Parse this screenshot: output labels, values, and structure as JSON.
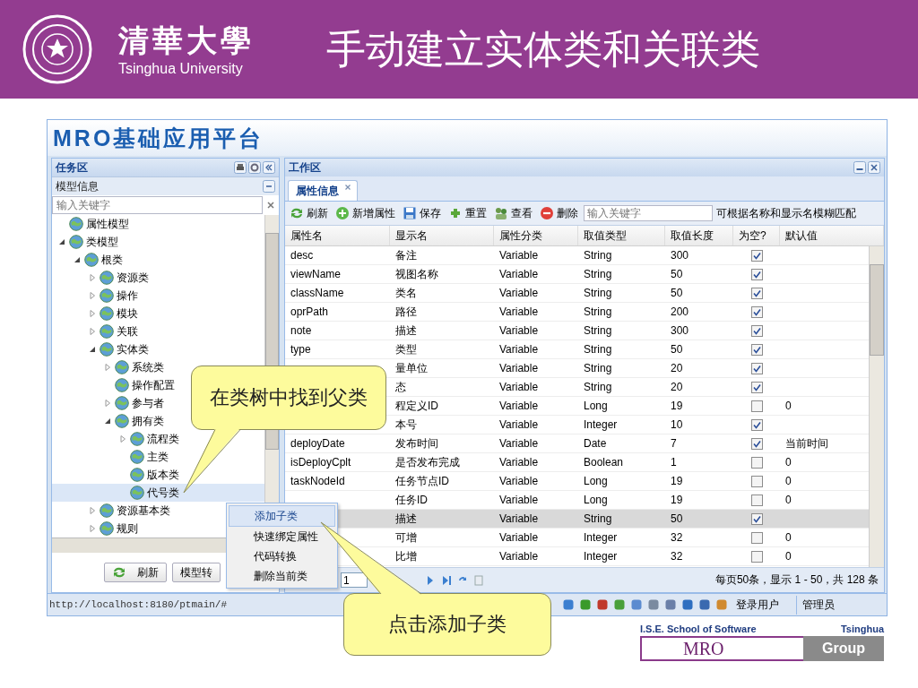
{
  "slide": {
    "university_name": "清華大學",
    "university_name_en": "Tsinghua University",
    "title": "手动建立实体类和关联类"
  },
  "app": {
    "title": "MRO基础应用平台",
    "task_panel": {
      "title": "任务区",
      "section": "模型信息",
      "search": {
        "placeholder": "输入关键字"
      },
      "tree": [
        {
          "label": "属性模型",
          "selected": false
        },
        {
          "label": "类模型",
          "selected": false,
          "expanded": true,
          "children": [
            {
              "label": "根类",
              "selected": false,
              "expanded": true,
              "children": [
                {
                  "label": "资源类",
                  "selected": false,
                  "expanded": false
                },
                {
                  "label": "操作",
                  "selected": false,
                  "expanded": false
                },
                {
                  "label": "模块",
                  "selected": false,
                  "expanded": false
                },
                {
                  "label": "关联",
                  "selected": false,
                  "expanded": false
                },
                {
                  "label": "实体类",
                  "selected": false,
                  "expanded": true,
                  "children": [
                    {
                      "label": "系统类",
                      "selected": false,
                      "expanded": false
                    },
                    {
                      "label": "操作配置",
                      "selected": false
                    },
                    {
                      "label": "参与者",
                      "selected": false,
                      "expanded": false
                    },
                    {
                      "label": "拥有类",
                      "selected": false,
                      "expanded": true,
                      "children": [
                        {
                          "label": "流程类",
                          "selected": false,
                          "expanded": false
                        },
                        {
                          "label": "主类",
                          "selected": false
                        },
                        {
                          "label": "版本类",
                          "selected": false
                        },
                        {
                          "label": "代号类",
                          "selected": true
                        }
                      ]
                    }
                  ]
                },
                {
                  "label": "资源基本类",
                  "selected": false,
                  "expanded": false
                },
                {
                  "label": "规则",
                  "selected": false,
                  "expanded": false
                }
              ]
            }
          ]
        }
      ],
      "buttons": [
        {
          "label": "刷新"
        },
        {
          "label": "模型转"
        }
      ]
    },
    "work_panel": {
      "title": "工作区",
      "tabs": [
        {
          "label": "属性信息",
          "selected": true
        }
      ],
      "toolbar": [
        {
          "label": "刷新"
        },
        {
          "label": "新增属性"
        },
        {
          "label": "保存"
        },
        {
          "label": "重置"
        },
        {
          "label": "查看"
        },
        {
          "label": "删除"
        }
      ],
      "search": {
        "placeholder": "输入关键字"
      },
      "search_hint": "可根据名称和显示名模糊匹配",
      "table": {
        "columns": [
          "属性名",
          "显示名",
          "属性分类",
          "取值类型",
          "取值长度",
          "为空?",
          "默认值"
        ],
        "rows": [
          {
            "name": "desc",
            "display": "备注",
            "category": "Variable",
            "type": "String",
            "length": "300",
            "nullable": true,
            "selected": false
          },
          {
            "name": "viewName",
            "display": "视图名称",
            "category": "Variable",
            "type": "String",
            "length": "50",
            "nullable": true,
            "selected": false
          },
          {
            "name": "className",
            "display": "类名",
            "category": "Variable",
            "type": "String",
            "length": "50",
            "nullable": true,
            "selected": false
          },
          {
            "name": "oprPath",
            "display": "路径",
            "category": "Variable",
            "type": "String",
            "length": "200",
            "nullable": true,
            "selected": false
          },
          {
            "name": "note",
            "display": "描述",
            "category": "Variable",
            "type": "String",
            "length": "300",
            "nullable": true,
            "selected": false
          },
          {
            "name": "type",
            "display": "类型",
            "category": "Variable",
            "type": "String",
            "length": "50",
            "nullable": true,
            "selected": false
          },
          {
            "display": "量单位",
            "category": "Variable",
            "type": "String",
            "length": "20",
            "nullable": true,
            "selected": false
          },
          {
            "display": "态",
            "category": "Variable",
            "type": "String",
            "length": "20",
            "nullable": true,
            "selected": false
          },
          {
            "display": "程定义ID",
            "category": "Variable",
            "type": "Long",
            "length": "19",
            "nullable": false,
            "default": "0",
            "selected": false
          },
          {
            "display": "本号",
            "category": "Variable",
            "type": "Integer",
            "length": "10",
            "nullable": true,
            "selected": false
          },
          {
            "name": "deployDate",
            "display": "发布时间",
            "category": "Variable",
            "type": "Date",
            "length": "7",
            "nullable": true,
            "default": "当前时间",
            "selected": false
          },
          {
            "name": "isDeployCplt",
            "display": "是否发布完成",
            "category": "Variable",
            "type": "Boolean",
            "length": "1",
            "nullable": false,
            "default": "0",
            "selected": false
          },
          {
            "name": "taskNodeId",
            "display": "任务节点ID",
            "category": "Variable",
            "type": "Long",
            "length": "19",
            "nullable": false,
            "default": "0",
            "selected": false
          },
          {
            "display": "任务ID",
            "category": "Variable",
            "type": "Long",
            "length": "19",
            "nullable": false,
            "default": "0",
            "selected": false
          },
          {
            "display": "描述",
            "category": "Variable",
            "type": "String",
            "length": "50",
            "nullable": true,
            "selected": true
          },
          {
            "display": "可增",
            "category": "Variable",
            "type": "Integer",
            "length": "32",
            "nullable": false,
            "default": "0",
            "selected": false
          },
          {
            "display": "比增",
            "category": "Variable",
            "type": "Integer",
            "length": "32",
            "nullable": false,
            "default": "0",
            "selected": false
          }
        ]
      },
      "pager": {
        "page": "1",
        "summary": "每页50条，显示 1 - 50，共 128 条"
      }
    },
    "status_bar": {
      "url": "http://localhost:8180/ptmain/#",
      "user_label": "登录用户",
      "user": "管理员"
    }
  },
  "context_menu": [
    {
      "label": "添加子类",
      "selected": true
    },
    {
      "label": "快速绑定属性",
      "selected": false
    },
    {
      "label": "代码转换",
      "selected": false
    },
    {
      "label": "删除当前类",
      "selected": false
    }
  ],
  "callouts": [
    {
      "text": "在类树中找到父类"
    },
    {
      "text": "点击添加子类"
    }
  ],
  "group_logo": {
    "school": "I.S.E. School of Software",
    "university": "Tsinghua",
    "project": "MRO",
    "team": "Group"
  }
}
